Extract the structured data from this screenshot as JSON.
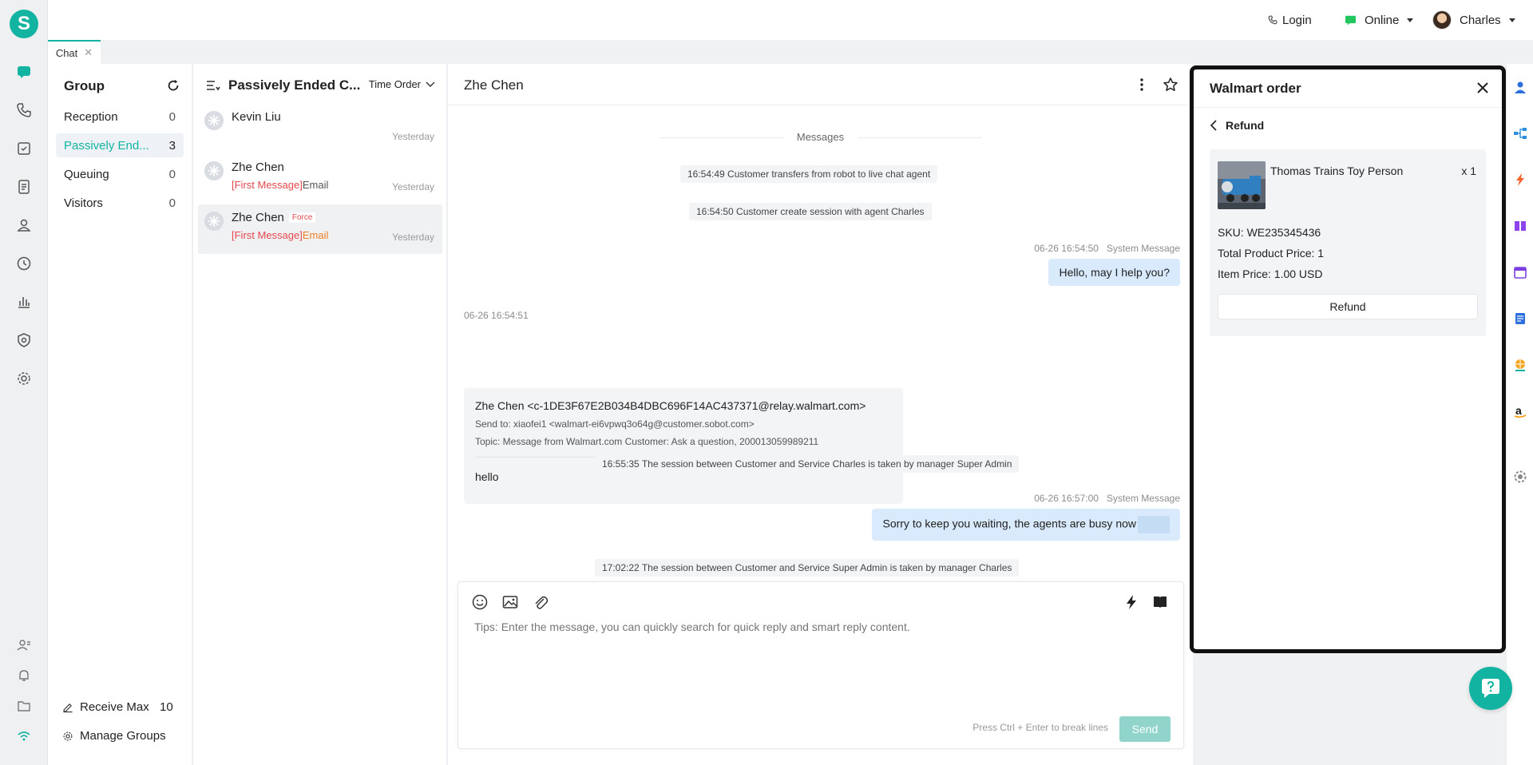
{
  "app": {
    "logo_letter": "S",
    "accent": "#13b3a1"
  },
  "topbar": {
    "login": "Login",
    "status": "Online",
    "user": "Charles"
  },
  "tabs": [
    {
      "label": "Chat"
    }
  ],
  "group": {
    "title": "Group",
    "items": [
      {
        "label": "Reception",
        "count": "0"
      },
      {
        "label": "Passively End...",
        "count": "3"
      },
      {
        "label": "Queuing",
        "count": "0"
      },
      {
        "label": "Visitors",
        "count": "0"
      }
    ],
    "receive_max_label": "Receive Max",
    "receive_max_value": "10",
    "manage_groups": "Manage Groups"
  },
  "conversations": {
    "title": "Passively Ended C...",
    "order": "Time Order",
    "items": [
      {
        "name": "Kevin Liu",
        "time": "Yesterday"
      },
      {
        "name": "Zhe Chen",
        "first": "[First Message]",
        "channel": "Email",
        "time": "Yesterday"
      },
      {
        "name": "Zhe Chen",
        "badge": "Force",
        "first": "[First Message]",
        "channel": "Email",
        "time": "Yesterday"
      }
    ]
  },
  "chat": {
    "title": "Zhe Chen",
    "divider": "Messages",
    "sys1": "16:54:49 Customer transfers from robot to live chat agent",
    "sys2": "16:54:50 Customer create session with agent Charles",
    "meta1_time": "06-26 16:54:50",
    "meta1_sender": "System Message",
    "bubble1": "Hello, may I help you?",
    "meta2_time": "06-26 16:54:51",
    "email": {
      "from": "Zhe Chen <c-1DE3F67E2B034B4DBC696F14AC437371@relay.walmart.com>",
      "send_to": "Send to: xiaofei1 <walmart-ei6vpwq3o64g@customer.sobot.com>",
      "topic": "Topic: Message from Walmart.com Customer:  Ask a question, 200013059989211",
      "body": "hello"
    },
    "sys3": "16:55:35 The session between Customer and Service Charles is taken by manager Super Admin",
    "meta3_time": "06-26 16:57:00",
    "meta3_sender": "System Message",
    "bubble2": "Sorry to keep you waiting, the agents are busy now",
    "sys4": "17:02:22 The session between Customer and Service Super Admin is taken by manager Charles"
  },
  "composer": {
    "placeholder": "Tips: Enter the message, you can quickly search for quick reply and smart reply content.",
    "hint": "Press Ctrl + Enter to break lines",
    "send": "Send"
  },
  "order": {
    "title": "Walmart order",
    "back_label": "Refund",
    "product": "Thomas Trains Toy Person",
    "qty": "x 1",
    "sku": "SKU: WE235345436",
    "total": "Total Product Price: 1",
    "item_price": "Item Price: 1.00 USD",
    "refund_button": "Refund"
  }
}
